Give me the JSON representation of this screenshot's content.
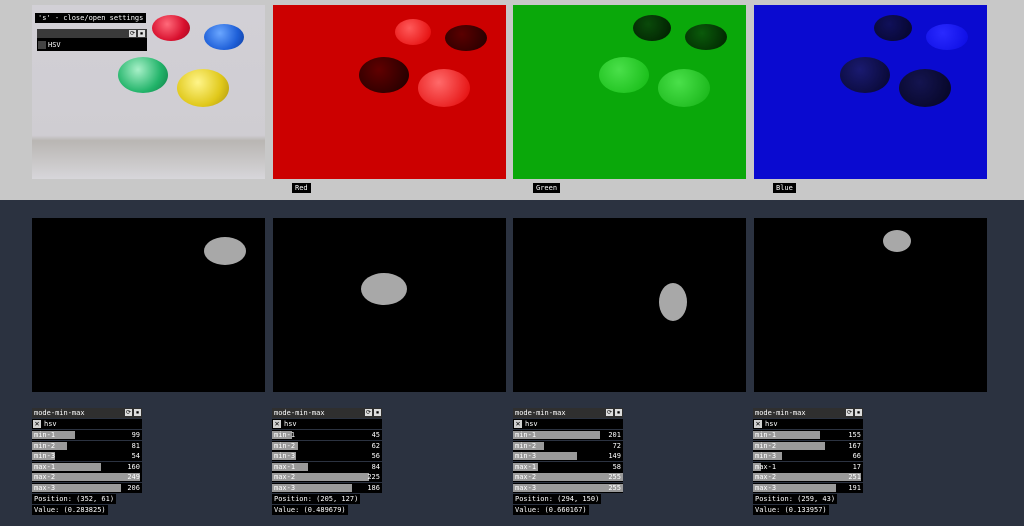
{
  "top_views": {
    "settings_hint": "'s' - close/open settings",
    "overlay_option": "HSV",
    "channel_labels": [
      "Red",
      "Green",
      "Blue"
    ]
  },
  "panels": [
    {
      "title": "mode-min-max",
      "toggle_label": "hsv",
      "sliders": [
        {
          "name": "min-1",
          "value": "99",
          "fraction": 0.39
        },
        {
          "name": "min-2",
          "value": "81",
          "fraction": 0.32
        },
        {
          "name": "min-3",
          "value": "54",
          "fraction": 0.21
        },
        {
          "name": "max-1",
          "value": "160",
          "fraction": 0.63
        },
        {
          "name": "max-2",
          "value": "249",
          "fraction": 0.98
        },
        {
          "name": "max-3",
          "value": "206",
          "fraction": 0.81
        }
      ],
      "position": "Position: (352, 61)",
      "value": "Value: (0.283825)"
    },
    {
      "title": "mode-min-max",
      "toggle_label": "hsv",
      "sliders": [
        {
          "name": "min-1",
          "value": "45",
          "fraction": 0.18
        },
        {
          "name": "min-2",
          "value": "62",
          "fraction": 0.24
        },
        {
          "name": "min-3",
          "value": "56",
          "fraction": 0.22
        },
        {
          "name": "max-1",
          "value": "84",
          "fraction": 0.33
        },
        {
          "name": "max-2",
          "value": "225",
          "fraction": 0.88
        },
        {
          "name": "max-3",
          "value": "186",
          "fraction": 0.73
        }
      ],
      "position": "Position: (205, 127)",
      "value": "Value: (0.489679)"
    },
    {
      "title": "mode-min-max",
      "toggle_label": "hsv",
      "sliders": [
        {
          "name": "min-1",
          "value": "201",
          "fraction": 0.79
        },
        {
          "name": "min-2",
          "value": "72",
          "fraction": 0.28
        },
        {
          "name": "min-3",
          "value": "149",
          "fraction": 0.58
        },
        {
          "name": "max-1",
          "value": "58",
          "fraction": 0.23
        },
        {
          "name": "max-2",
          "value": "255",
          "fraction": 1.0
        },
        {
          "name": "max-3",
          "value": "255",
          "fraction": 1.0
        }
      ],
      "position": "Position: (294, 150)",
      "value": "Value: (0.660167)"
    },
    {
      "title": "mode-min-max",
      "toggle_label": "hsv",
      "sliders": [
        {
          "name": "min-1",
          "value": "155",
          "fraction": 0.61
        },
        {
          "name": "min-2",
          "value": "167",
          "fraction": 0.65
        },
        {
          "name": "min-3",
          "value": "66",
          "fraction": 0.26
        },
        {
          "name": "max-1",
          "value": "17",
          "fraction": 0.07
        },
        {
          "name": "max-2",
          "value": "251",
          "fraction": 0.98
        },
        {
          "name": "max-3",
          "value": "191",
          "fraction": 0.75
        }
      ],
      "position": "Position: (259, 43)",
      "value": "Value: (0.133957)"
    }
  ]
}
